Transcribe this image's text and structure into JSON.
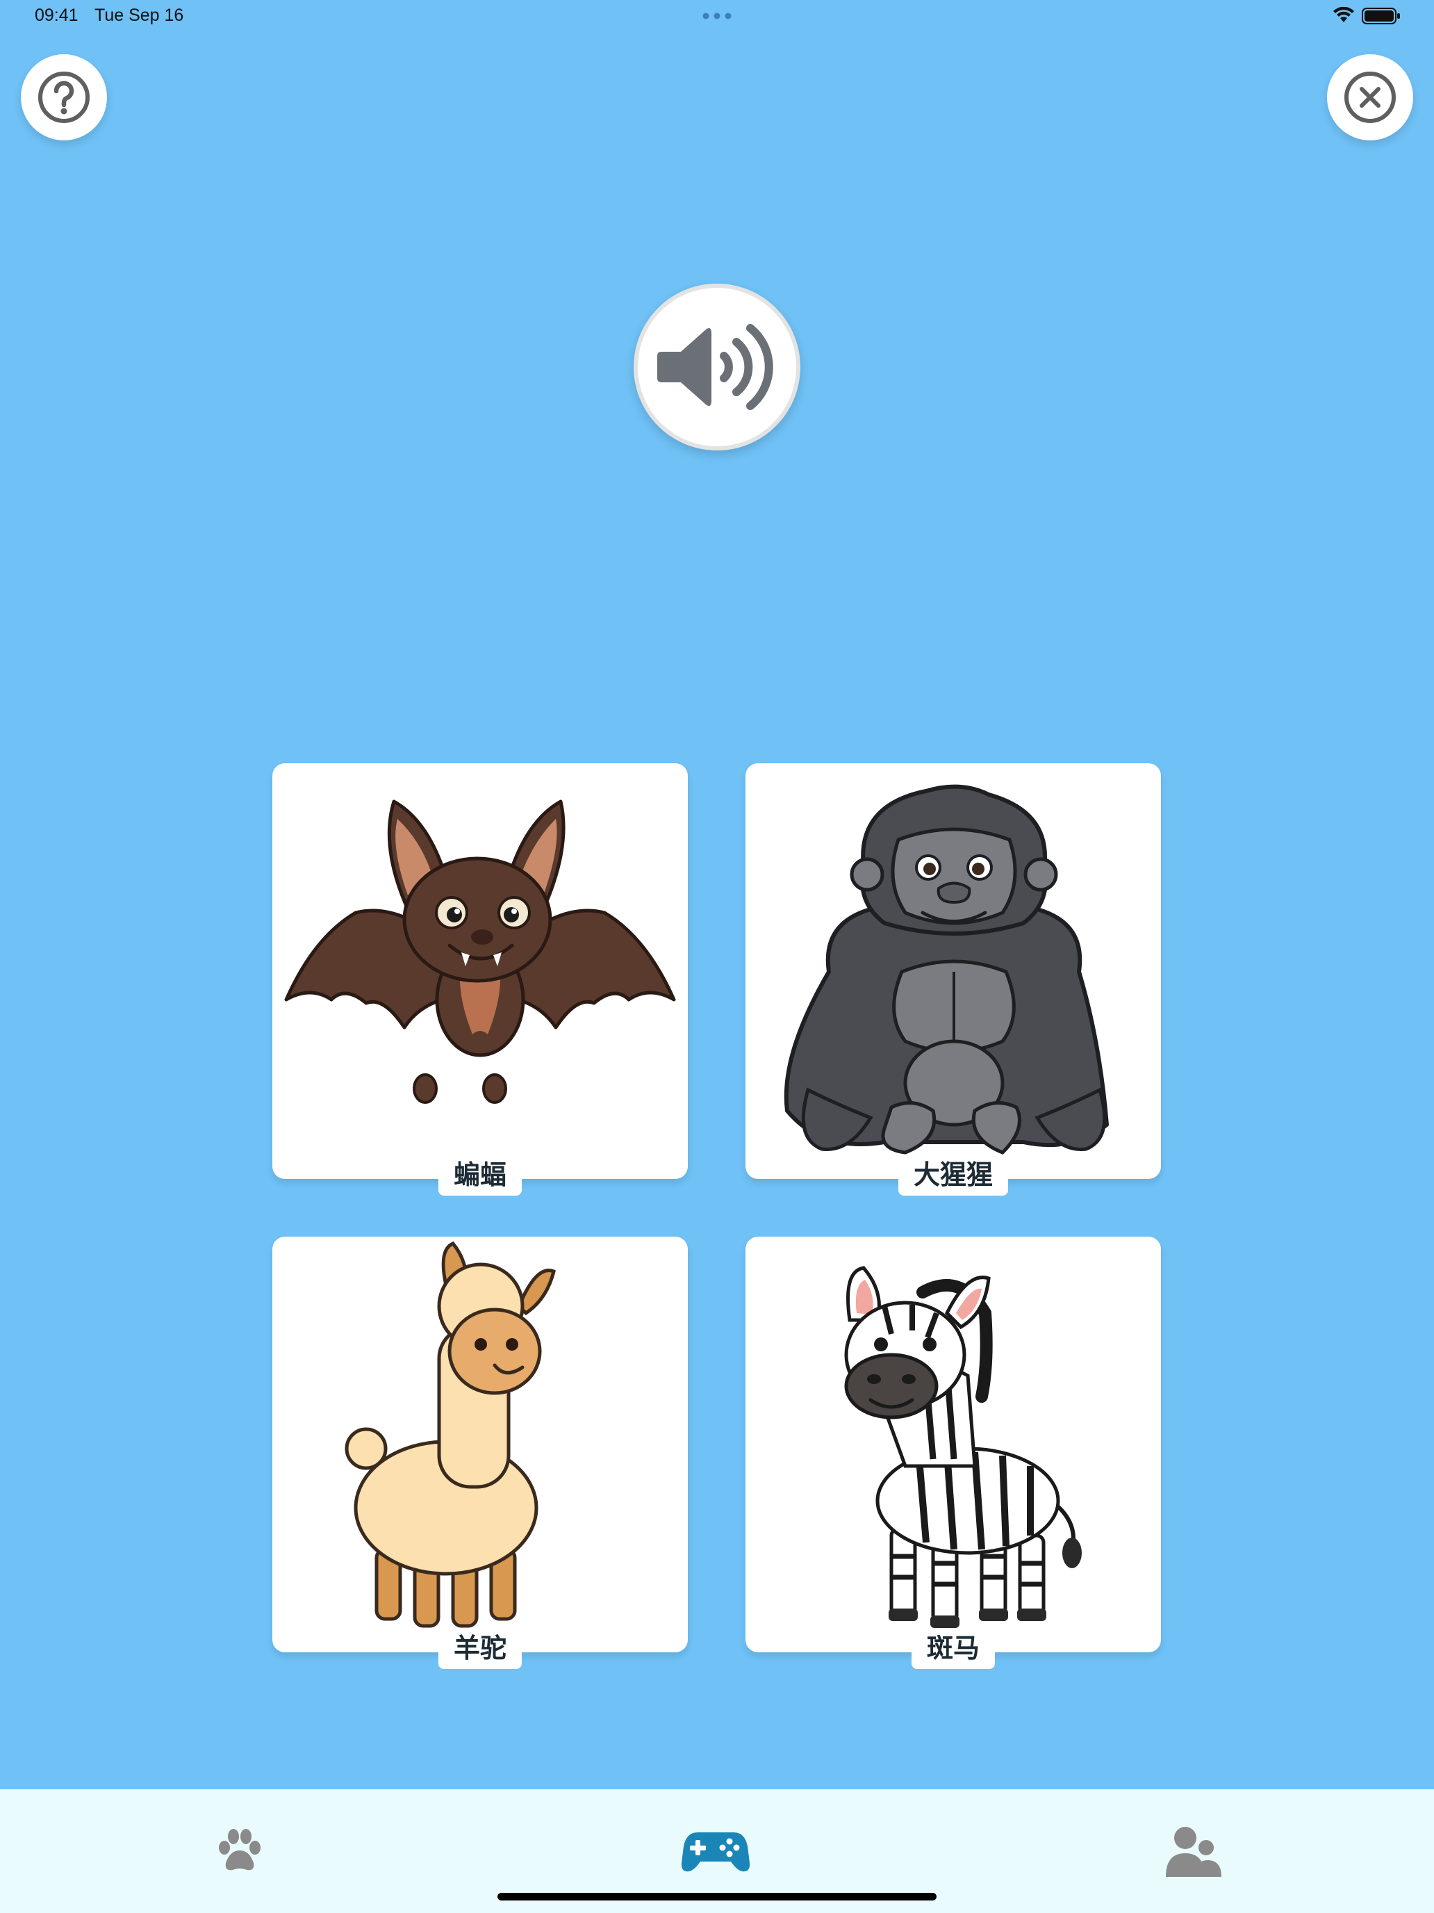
{
  "status_bar": {
    "time": "09:41",
    "date": "Tue Sep 16"
  },
  "header": {
    "help_icon": "question-circle-icon",
    "close_icon": "close-circle-icon"
  },
  "speaker": {
    "icon": "speaker-volume-icon"
  },
  "cards": [
    {
      "label": "蝙蝠",
      "animal": "bat"
    },
    {
      "label": "大猩猩",
      "animal": "gorilla"
    },
    {
      "label": "羊驼",
      "animal": "alpaca"
    },
    {
      "label": "斑马",
      "animal": "zebra"
    }
  ],
  "tab_bar": {
    "tabs": [
      {
        "icon": "paw-icon",
        "active": false
      },
      {
        "icon": "gamepad-icon",
        "active": true
      },
      {
        "icon": "people-icon",
        "active": false
      }
    ],
    "active_color": "#1A86B8",
    "inactive_color": "#8A8A8A"
  },
  "colors": {
    "background": "#6FC1F6",
    "card": "#FFFFFF"
  }
}
